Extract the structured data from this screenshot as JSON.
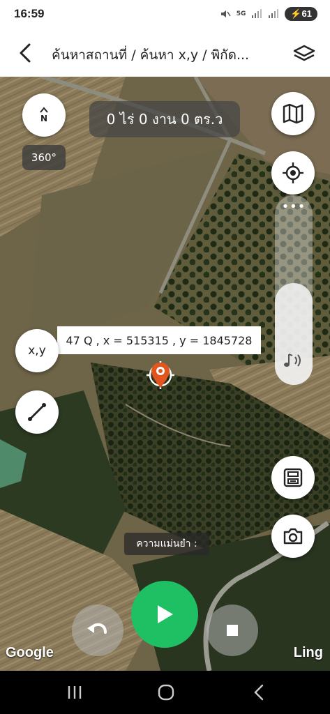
{
  "status": {
    "time": "16:59",
    "battery": "61",
    "network": "5G"
  },
  "header": {
    "title": "ค้นหาสถานที่ / ค้นหา x,y / พิกัด..."
  },
  "map": {
    "area_text": "0 ไร่ 0 งาน 0 ตร.ว",
    "compass_letter": "N",
    "rotation_label": "360°",
    "coord_text": "47 Q , x = 515315 , y = 1845728",
    "xy_button_label": "x,y",
    "accuracy_label": "ความแม่นยำ :",
    "attribution": "Google",
    "watermark": "Ling",
    "slider_dots": "•••"
  },
  "icons": [
    "back-arrow-icon",
    "layers-icon",
    "map-icon",
    "locate-icon",
    "volume-icon",
    "ruler-icon",
    "save-icon",
    "camera-icon",
    "undo-icon",
    "play-icon",
    "stop-icon",
    "pin-icon"
  ],
  "colors": {
    "play": "#1fbf63",
    "pin": "#e2551f"
  }
}
